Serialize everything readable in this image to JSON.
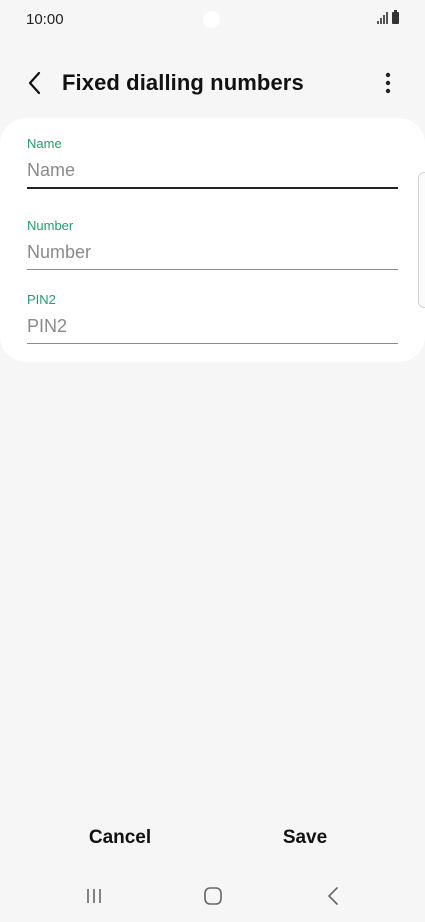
{
  "status_bar": {
    "time": "10:00"
  },
  "header": {
    "title": "Fixed dialling numbers",
    "back_icon": "chevron-left-icon",
    "more_icon": "more-vertical-icon"
  },
  "form": {
    "fields": [
      {
        "label": "Name",
        "placeholder": "Name",
        "value": "",
        "active": true
      },
      {
        "label": "Number",
        "placeholder": "Number",
        "value": "",
        "active": false
      },
      {
        "label": "PIN2",
        "placeholder": "PIN2",
        "value": "",
        "active": false
      }
    ]
  },
  "actions": {
    "cancel_label": "Cancel",
    "save_label": "Save"
  },
  "navigation": {
    "recents_icon": "recents-icon",
    "home_icon": "home-icon",
    "back_icon": "back-icon"
  },
  "colors": {
    "background": "#f6f6f6",
    "card": "#ffffff",
    "label_accent": "#21a06b",
    "text": "#111111"
  }
}
